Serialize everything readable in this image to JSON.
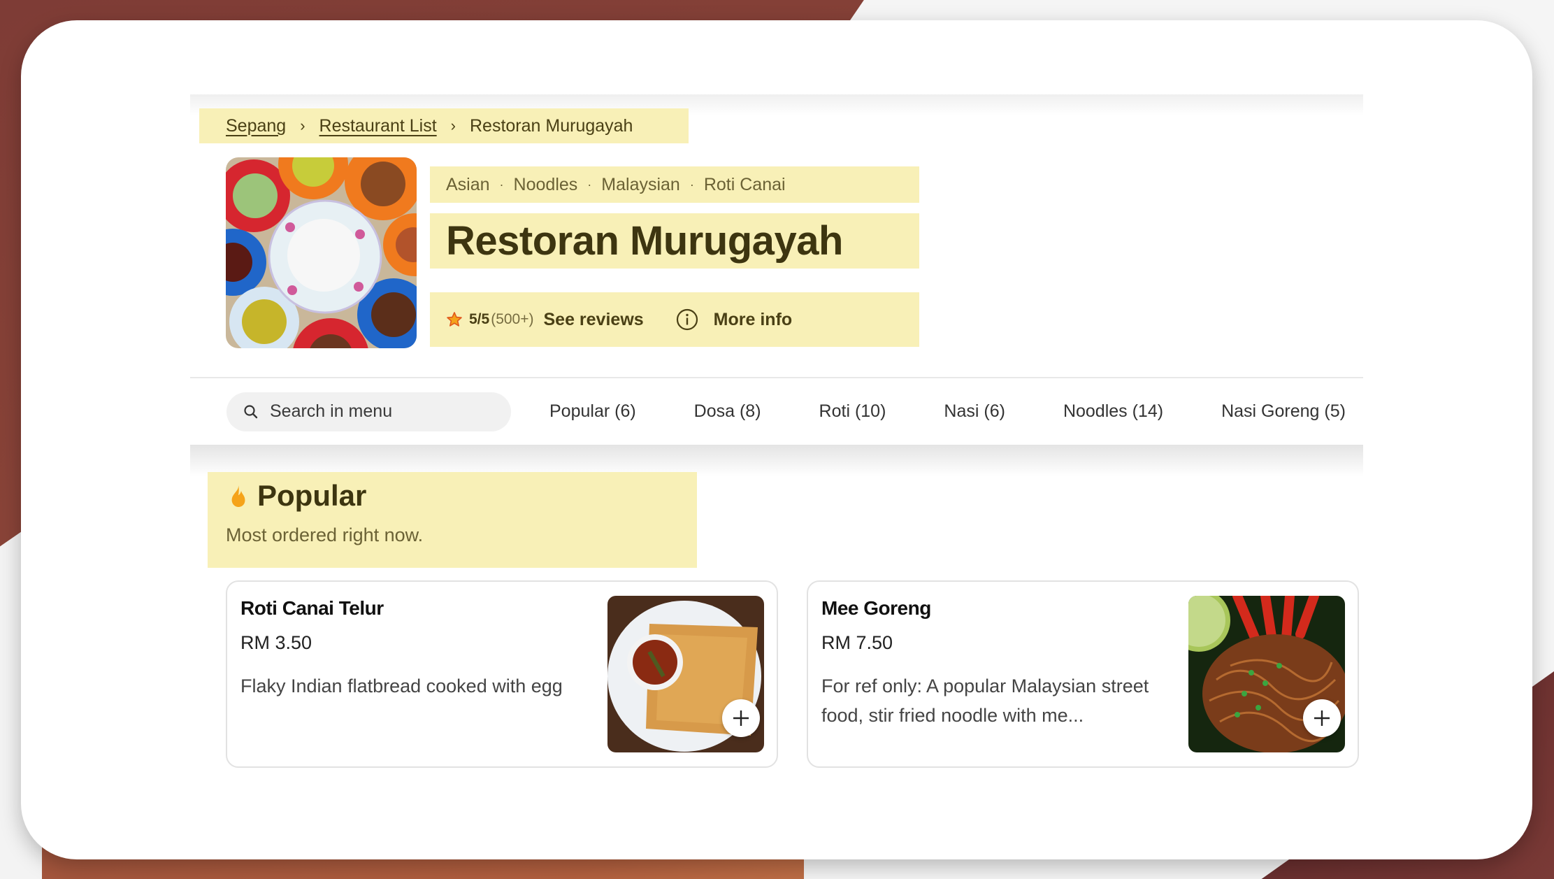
{
  "breadcrumb": {
    "items": [
      {
        "label": "Sepang",
        "link": true
      },
      {
        "label": "Restaurant List",
        "link": true
      },
      {
        "label": "Restoran Murugayah",
        "link": false
      }
    ],
    "separator": "›"
  },
  "restaurant": {
    "name": "Restoran Murugayah",
    "tags": [
      "Asian",
      "Noodles",
      "Malaysian",
      "Roti Canai"
    ],
    "tag_separator": "·",
    "rating": "5/5",
    "rating_count": "(500+)",
    "see_reviews_label": "See reviews",
    "more_info_label": "More info"
  },
  "menu_nav": {
    "search_placeholder": "Search in menu",
    "tabs": [
      {
        "label": "Popular (6)"
      },
      {
        "label": "Dosa (8)"
      },
      {
        "label": "Roti (10)"
      },
      {
        "label": "Nasi (6)"
      },
      {
        "label": "Noodles (14)"
      },
      {
        "label": "Nasi Goreng (5)"
      }
    ]
  },
  "section": {
    "title": "Popular",
    "subtitle": "Most ordered right now.",
    "icon": "flame-icon"
  },
  "items": [
    {
      "name": "Roti Canai Telur",
      "price": "RM 3.50",
      "description": "Flaky Indian flatbread cooked with egg",
      "add_label": "+"
    },
    {
      "name": "Mee Goreng",
      "price": "RM 7.50",
      "description": "For ref only: A popular Malaysian street food, stir fried noodle with me...",
      "add_label": "+"
    }
  ],
  "colors": {
    "highlight": "#f8f0b7",
    "title_text": "#3d3510",
    "star": "#f08a00",
    "flame": "#f5a31a"
  }
}
